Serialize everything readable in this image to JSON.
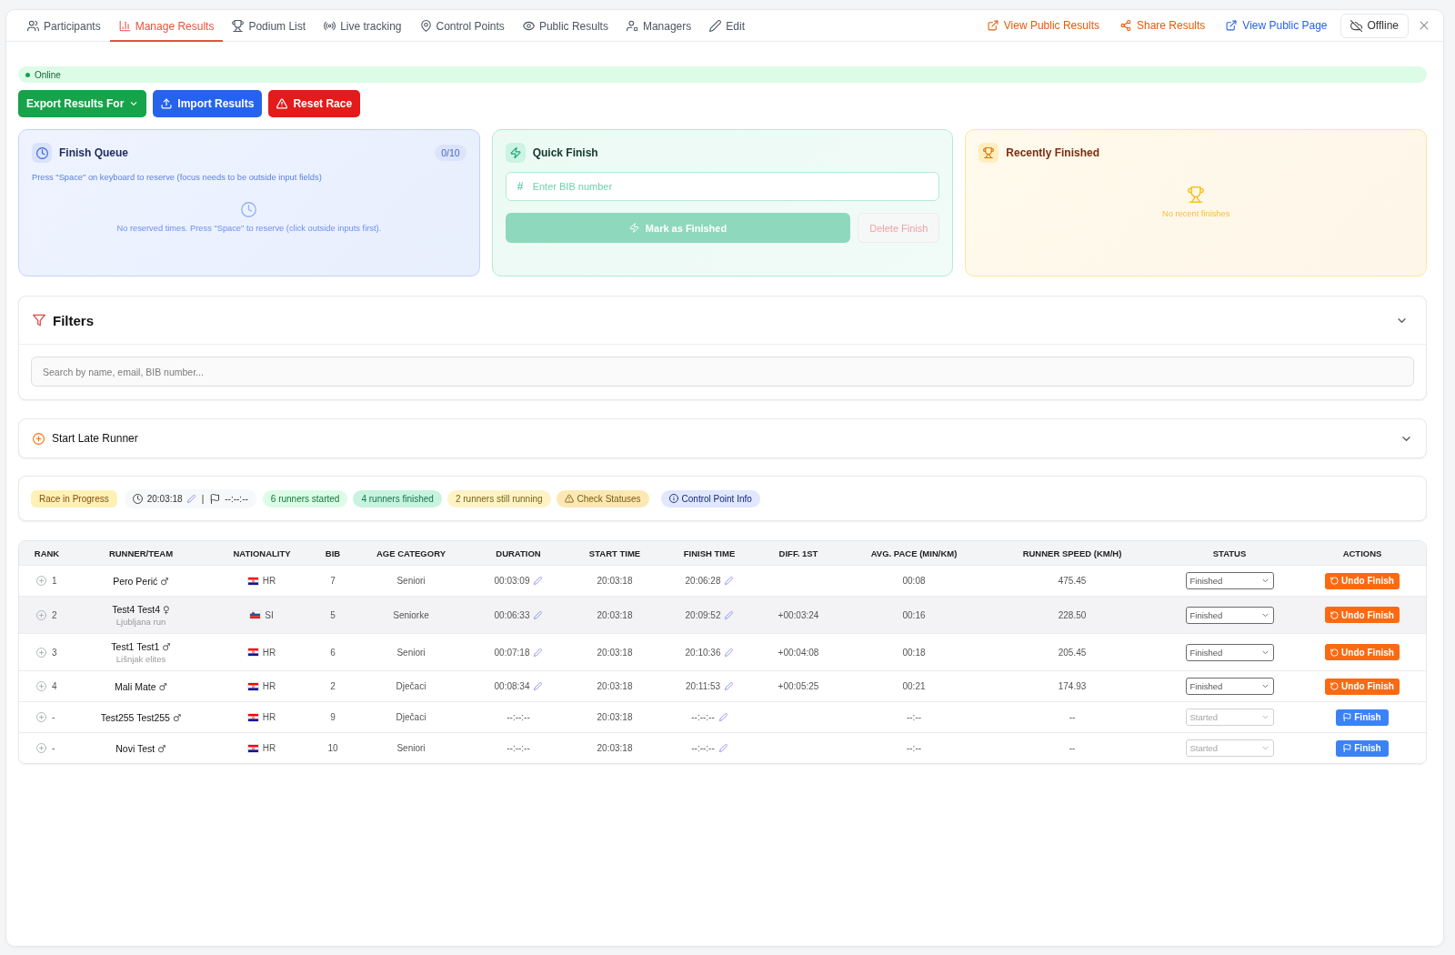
{
  "nav": {
    "tabs": [
      {
        "label": "Participants",
        "selected": false
      },
      {
        "label": "Manage Results",
        "selected": true
      },
      {
        "label": "Podium List",
        "selected": false
      },
      {
        "label": "Live tracking",
        "selected": false
      },
      {
        "label": "Control Points",
        "selected": false
      },
      {
        "label": "Public Results",
        "selected": false
      },
      {
        "label": "Managers",
        "selected": false
      },
      {
        "label": "Edit",
        "selected": false
      }
    ],
    "links": [
      {
        "label": "View Public Results",
        "kind": "external",
        "color": "#ea580c"
      },
      {
        "label": "Share Results",
        "kind": "share",
        "color": "#ea580c"
      },
      {
        "label": "View Public Page",
        "kind": "external",
        "color": "#2563eb"
      }
    ],
    "offline_button": {
      "label": "Offline"
    }
  },
  "connection": {
    "label": "Online"
  },
  "actions": [
    {
      "kind": "export",
      "label": "Export Results For"
    },
    {
      "kind": "import",
      "label": "Import Results"
    },
    {
      "kind": "reset",
      "label": "Reset Race"
    }
  ],
  "finish_queue": {
    "title": "Finish Queue",
    "count": "0/10",
    "hint": "Press \"Space\" on keyboard to reserve (focus needs to be outside input fields)",
    "empty_text": "No reserved times. Press \"Space\" to reserve (click outside inputs first)."
  },
  "quick_finish": {
    "title": "Quick Finish",
    "bib_input": {
      "prefix": "#",
      "placeholder": "Enter BIB number"
    },
    "mark_button": {
      "label": "Mark as Finished",
      "disabled": true
    },
    "delete_button": {
      "label": "Delete Finish",
      "disabled": true
    }
  },
  "recently_finished": {
    "title": "Recently Finished",
    "empty_text": "No recent finishes"
  },
  "filters": {
    "title": "Filters",
    "expanded": true,
    "search": {
      "placeholder": "Search by name, email, BIB number..."
    }
  },
  "start_late_runner": {
    "title": "Start Late Runner",
    "expanded": false
  },
  "race_status": {
    "state": "Race in Progress",
    "start_time": "20:03:18",
    "separator": "|",
    "finish_time": "--:--:--",
    "pills": [
      {
        "kind": "count",
        "label": "6 runners started",
        "color": "#dcfce7"
      },
      {
        "kind": "count",
        "label": "4 runners finished",
        "color": "#c8f3df"
      },
      {
        "kind": "count",
        "label": "2 runners still running",
        "color": "#fef3c7"
      },
      {
        "kind": "warning",
        "label": "Check Statuses",
        "color": "#fde8b4"
      },
      {
        "kind": "info",
        "label": "Control Point Info",
        "color": "#e0e7ff"
      }
    ]
  },
  "table": {
    "columns": [
      "RANK",
      "RUNNER/TEAM",
      "NATIONALITY",
      "BIB",
      "AGE CATEGORY",
      "DURATION",
      "START TIME",
      "FINISH TIME",
      "DIFF. 1ST",
      "AVG. PACE (MIN/KM)",
      "RUNNER SPEED (KM/H)",
      "STATUS",
      "ACTIONS"
    ],
    "rows": [
      {
        "highlighted": false,
        "rank": "1",
        "name": "Pero Perić",
        "gender": "♂",
        "nationality": {
          "code": "HR",
          "kind": "croatia"
        },
        "bib": "7",
        "age_category": "Seniori",
        "duration": {
          "text": "00:03:09",
          "editable": true
        },
        "start_time": "20:03:18",
        "finish_time": {
          "text": "20:06:28",
          "editable": true
        },
        "pace": "00:08",
        "speed": "475.45",
        "status": {
          "value": "Finished",
          "disabled": false
        },
        "action": {
          "kind": "undo",
          "label": "Undo Finish"
        }
      },
      {
        "highlighted": true,
        "rank": "2",
        "name": "Test4 Test4",
        "gender": "♀",
        "team": "Ljubljana run",
        "nationality": {
          "code": "SI",
          "kind": "slovenia"
        },
        "bib": "5",
        "age_category": "Seniorke",
        "duration": {
          "text": "00:06:33",
          "editable": true
        },
        "start_time": "20:03:18",
        "finish_time": {
          "text": "20:09:52",
          "editable": true
        },
        "diff": "+00:03:24",
        "pace": "00:16",
        "speed": "228.50",
        "status": {
          "value": "Finished",
          "disabled": false
        },
        "action": {
          "kind": "undo",
          "label": "Undo Finish"
        }
      },
      {
        "highlighted": false,
        "rank": "3",
        "name": "Test1 Test1",
        "gender": "♂",
        "team": "Lišnjak elites",
        "nationality": {
          "code": "HR",
          "kind": "croatia"
        },
        "bib": "6",
        "age_category": "Seniori",
        "duration": {
          "text": "00:07:18",
          "editable": true
        },
        "start_time": "20:03:18",
        "finish_time": {
          "text": "20:10:36",
          "editable": true
        },
        "diff": "+00:04:08",
        "pace": "00:18",
        "speed": "205.45",
        "status": {
          "value": "Finished",
          "disabled": false
        },
        "action": {
          "kind": "undo",
          "label": "Undo Finish"
        }
      },
      {
        "highlighted": false,
        "rank": "4",
        "name": "Mali Mate",
        "gender": "♂",
        "nationality": {
          "code": "HR",
          "kind": "croatia"
        },
        "bib": "2",
        "age_category": "Dječaci",
        "duration": {
          "text": "00:08:34",
          "editable": true
        },
        "start_time": "20:03:18",
        "finish_time": {
          "text": "20:11:53",
          "editable": true
        },
        "diff": "+00:05:25",
        "pace": "00:21",
        "speed": "174.93",
        "status": {
          "value": "Finished",
          "disabled": false
        },
        "action": {
          "kind": "undo",
          "label": "Undo Finish"
        }
      },
      {
        "highlighted": false,
        "rank": "-",
        "name": "Test255 Test255",
        "gender": "♂",
        "nationality": {
          "code": "HR",
          "kind": "croatia"
        },
        "bib": "9",
        "age_category": "Dječaci",
        "duration": {
          "text": "--:--:--",
          "editable": false
        },
        "start_time": "20:03:18",
        "finish_time": {
          "text": "--:--:--",
          "editable": true
        },
        "pace": "--:--",
        "speed": "--",
        "status": {
          "value": "Started",
          "disabled": true
        },
        "action": {
          "kind": "finish",
          "label": "Finish"
        }
      },
      {
        "highlighted": false,
        "rank": "-",
        "name": "Novi Test",
        "gender": "♂",
        "nationality": {
          "code": "HR",
          "kind": "croatia"
        },
        "bib": "10",
        "age_category": "Seniori",
        "duration": {
          "text": "--:--:--",
          "editable": false
        },
        "start_time": "20:03:18",
        "finish_time": {
          "text": "--:--:--",
          "editable": true
        },
        "pace": "--:--",
        "speed": "--",
        "status": {
          "value": "Started",
          "disabled": true
        },
        "action": {
          "kind": "finish",
          "label": "Finish"
        }
      }
    ]
  }
}
